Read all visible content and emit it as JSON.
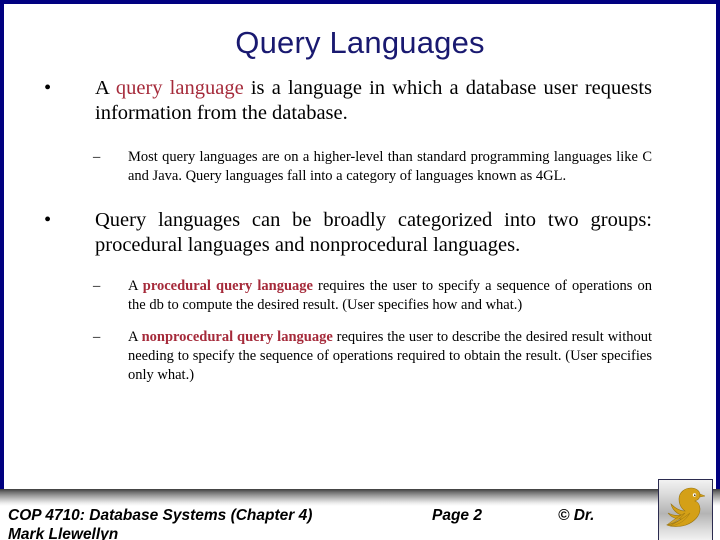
{
  "slide": {
    "title": "Query Languages",
    "colors": {
      "frame_navy": "#000080",
      "title_navy": "#191970",
      "highlight_red": "#A52A3A",
      "body_black": "#000000",
      "logo_gold": "#D4A017"
    },
    "bullets": {
      "b1_marker": "•",
      "b1_pre": "A ",
      "b1_hl": "query language",
      "b1_post": " is a language in which a database user requests information from the database.",
      "b1s1_marker": "–",
      "b1s1_text": "Most query languages are on a higher-level than standard programming languages like  C  and Java.   Query languages fall into a category of languages known as 4GL.",
      "b2_marker": "•",
      "b2_text": "Query languages can be broadly categorized into two groups:    procedural languages and nonprocedural languages.",
      "b2s1_marker": "–",
      "b2s1_pre": "A ",
      "b2s1_hl": "procedural query language",
      "b2s1_post": " requires the user to specify a sequence of operations on the db to compute the desired result.  (User specifies how and what.)",
      "b2s2_marker": "–",
      "b2s2_pre": "A ",
      "b2s2_hl": "nonprocedural query language",
      "b2s2_post": " requires the user to describe the desired result without needing to specify the  sequence of operations required to obtain the result. (User specifies only what.)"
    }
  },
  "footer": {
    "course": "COP 4710: Database Systems  (Chapter 4)",
    "page": "Page 2",
    "copyright": "© Dr.",
    "author": "Mark Llewellyn",
    "logo_name": "ucf-pegasus-logo"
  }
}
